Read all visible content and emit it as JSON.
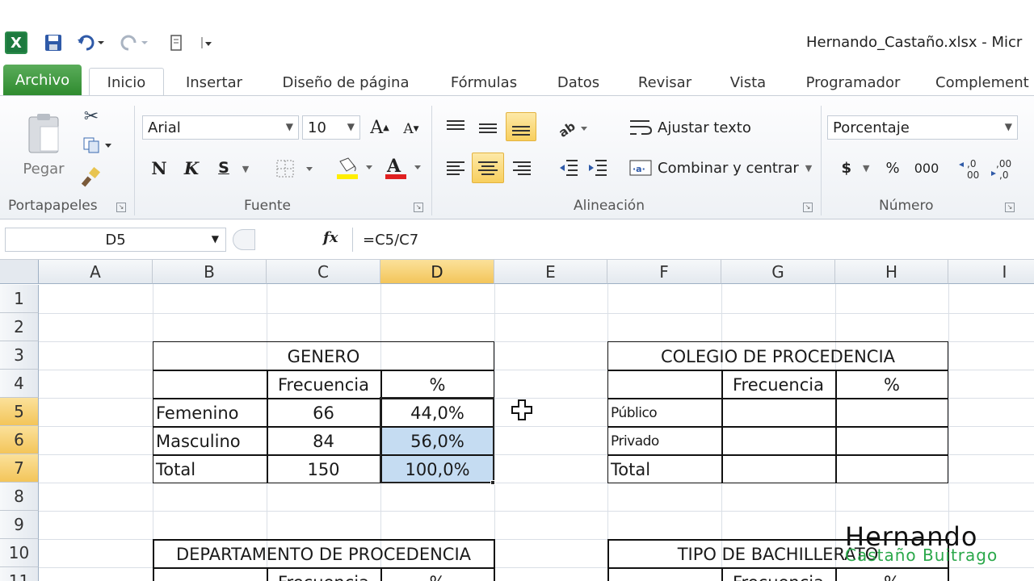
{
  "window": {
    "title": "Hernando_Castaño.xlsx  -  Micr"
  },
  "tabs": [
    "Archivo",
    "Inicio",
    "Insertar",
    "Diseño de página",
    "Fórmulas",
    "Datos",
    "Revisar",
    "Vista",
    "Programador",
    "Complement"
  ],
  "ribbon": {
    "clipboard": {
      "paste": "Pegar",
      "label": "Portapapeles"
    },
    "font": {
      "name": "Arial",
      "size": "10",
      "bold": "N",
      "italic": "K",
      "underline": "S",
      "label": "Fuente"
    },
    "alignment": {
      "wrap": "Ajustar texto",
      "merge": "Combinar y centrar",
      "label": "Alineación"
    },
    "number": {
      "format": "Porcentaje",
      "currency": "$",
      "percent": "%",
      "thousands": "000",
      "label": "Número"
    }
  },
  "formula_bar": {
    "name_box": "D5",
    "fx": "fx",
    "formula": "=C5/C7"
  },
  "sheet": {
    "columns": [
      "A",
      "B",
      "C",
      "D",
      "E",
      "F",
      "G",
      "H",
      "I"
    ],
    "rows": [
      "1",
      "2",
      "3",
      "4",
      "5",
      "6",
      "7",
      "8",
      "9",
      "10",
      "11"
    ],
    "genero": {
      "title": "GENERO",
      "headers": [
        "Frecuencia",
        "%"
      ],
      "rows": [
        {
          "label": "Femenino",
          "freq": "66",
          "pct": "44,0%"
        },
        {
          "label": "Masculino",
          "freq": "84",
          "pct": "56,0%"
        },
        {
          "label": "Total",
          "freq": "150",
          "pct": "100,0%"
        }
      ]
    },
    "colegio": {
      "title": "COLEGIO DE PROCEDENCIA",
      "headers": [
        "Frecuencia",
        "%"
      ],
      "rows": [
        "Público",
        "Privado",
        "Total"
      ]
    },
    "departamento": {
      "title": "DEPARTAMENTO DE PROCEDENCIA",
      "headers": [
        "Frecuencia",
        "%"
      ]
    },
    "bachillerato": {
      "title": "TIPO DE BACHILLERATO",
      "headers": [
        "Frecuencia",
        "%"
      ]
    }
  },
  "watermark": {
    "line1": "Hernando",
    "line2": "Castaño Buitrago"
  }
}
